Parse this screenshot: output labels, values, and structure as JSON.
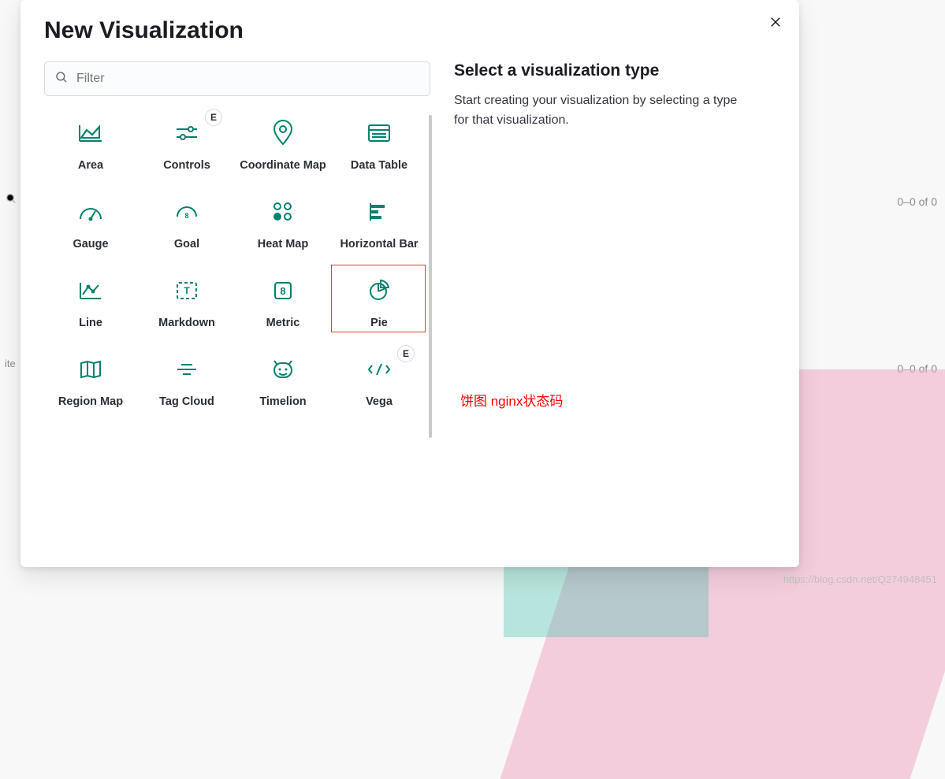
{
  "background": {
    "count_text": "0–0 of 0",
    "left_hint": "  ite"
  },
  "modal": {
    "title": "New Visualization",
    "filter_placeholder": "Filter",
    "right": {
      "heading": "Select a visualization type",
      "body": "Start creating your visualization by selecting a type for that visualization."
    },
    "exp_badge": "E",
    "tiles": [
      {
        "key": "area",
        "label": "Area"
      },
      {
        "key": "controls",
        "label": "Controls",
        "badge": "E"
      },
      {
        "key": "coord-map",
        "label": "Coordinate Map"
      },
      {
        "key": "data-table",
        "label": "Data Table"
      },
      {
        "key": "gauge",
        "label": "Gauge"
      },
      {
        "key": "goal",
        "label": "Goal"
      },
      {
        "key": "heat-map",
        "label": "Heat Map"
      },
      {
        "key": "hbar",
        "label": "Horizontal Bar"
      },
      {
        "key": "line",
        "label": "Line"
      },
      {
        "key": "markdown",
        "label": "Markdown"
      },
      {
        "key": "metric",
        "label": "Metric"
      },
      {
        "key": "pie",
        "label": "Pie"
      },
      {
        "key": "region-map",
        "label": "Region Map"
      },
      {
        "key": "tag-cloud",
        "label": "Tag Cloud"
      },
      {
        "key": "timelion",
        "label": "Timelion"
      },
      {
        "key": "vega",
        "label": "Vega",
        "badge": "E"
      }
    ]
  },
  "annotation_text": "饼图 nginx状态码",
  "watermark": "https://blog.csdn.net/Q274948451"
}
